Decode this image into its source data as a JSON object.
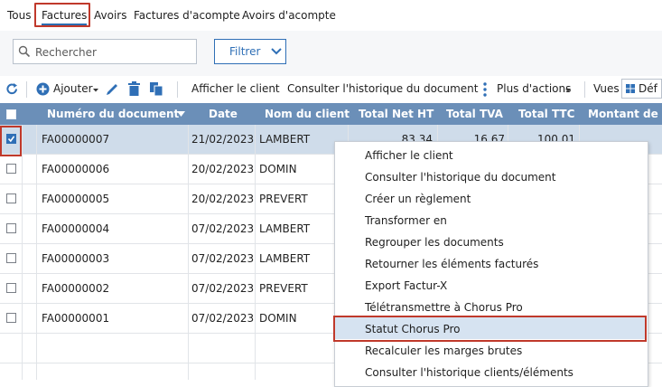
{
  "tabs": [
    "Tous",
    "Factures",
    "Avoirs",
    "Factures d'acompte",
    "Avoirs d'acompte"
  ],
  "active_tab": "Factures",
  "search": {
    "placeholder": "Rechercher"
  },
  "filter": {
    "label": "Filtrer"
  },
  "toolbar": {
    "add_label": "Ajouter",
    "show_client": "Afficher le client",
    "history": "Consulter l'historique du document",
    "more_actions": "Plus d'actions",
    "views": "Vues",
    "views_value": "Déf"
  },
  "table": {
    "columns": [
      "Numéro du document",
      "Date",
      "Nom du client",
      "Total Net HT",
      "Total TVA",
      "Total TTC",
      "Montant de l'"
    ],
    "rows": [
      {
        "doc": "FA00000007",
        "date": "21/02/2023",
        "client": "LAMBERT",
        "net": "83,34",
        "tva": "16,67",
        "ttc": "100,01",
        "selected": true
      },
      {
        "doc": "FA00000006",
        "date": "20/02/2023",
        "client": "DOMIN",
        "selected": false
      },
      {
        "doc": "FA00000005",
        "date": "20/02/2023",
        "client": "PREVERT",
        "selected": false
      },
      {
        "doc": "FA00000004",
        "date": "07/02/2023",
        "client": "LAMBERT",
        "selected": false
      },
      {
        "doc": "FA00000003",
        "date": "07/02/2023",
        "client": "LAMBERT",
        "selected": false
      },
      {
        "doc": "FA00000002",
        "date": "07/02/2023",
        "client": "PREVERT",
        "selected": false
      },
      {
        "doc": "FA00000001",
        "date": "07/02/2023",
        "client": "DOMIN",
        "selected": false
      }
    ]
  },
  "context_menu": {
    "items": [
      "Afficher le client",
      "Consulter l'historique du document",
      "Créer un règlement",
      "Transformer en",
      "Regrouper les documents",
      "Retourner les éléments facturés",
      "Export Factur-X",
      "Télétransmettre à Chorus Pro",
      "Statut Chorus Pro",
      "Recalculer les marges brutes",
      "Consulter l'historique clients/éléments"
    ],
    "highlighted": "Statut Chorus Pro"
  },
  "colors": {
    "accent": "#2f6fb6",
    "header_bg": "#6b8fb8",
    "highlight_border": "#c0392b",
    "selected_row": "#cfdcea"
  }
}
